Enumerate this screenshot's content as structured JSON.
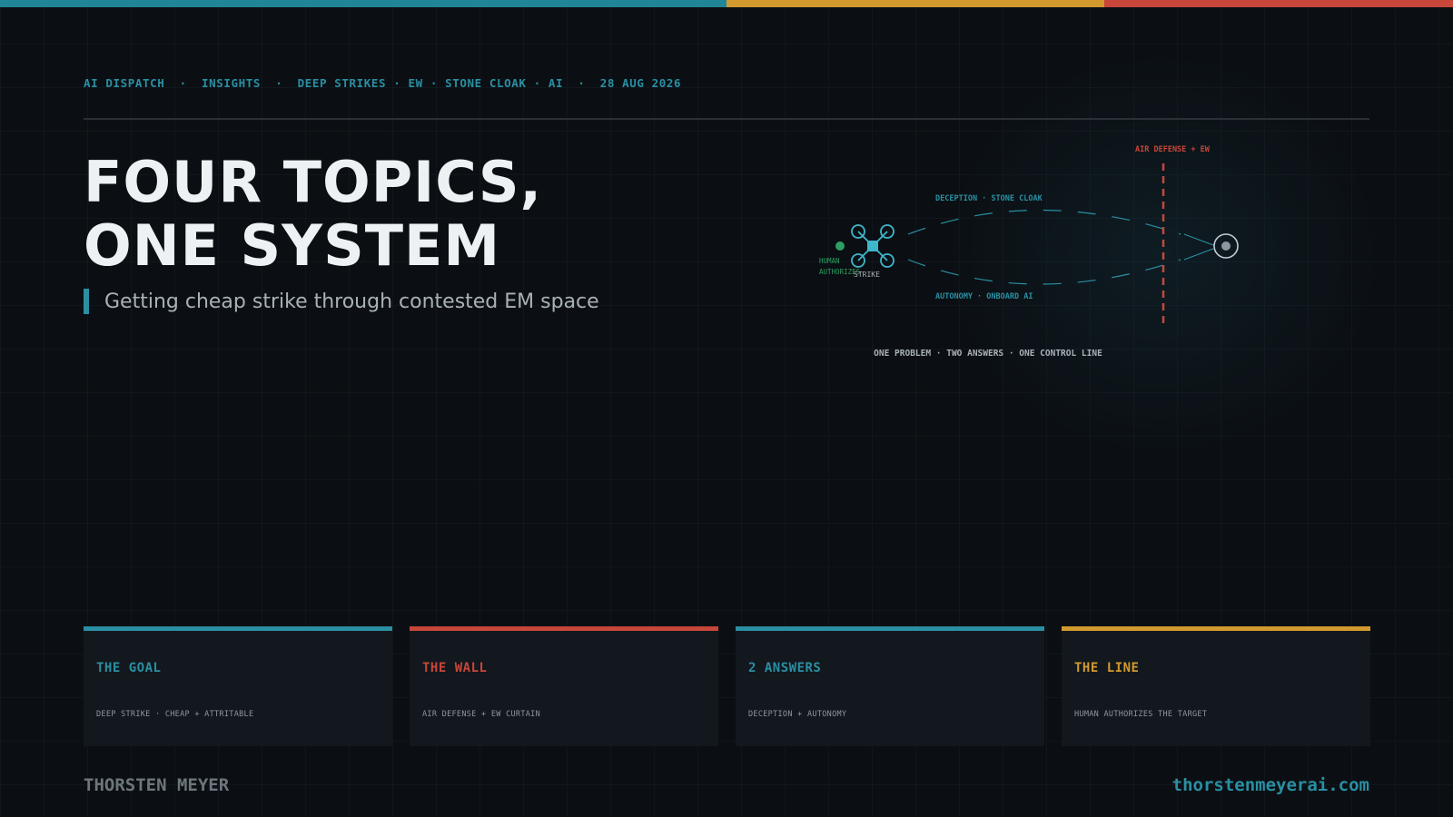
{
  "colors": {
    "teal": "#2a8fa3",
    "amber": "#d29a2e",
    "red": "#c8463a",
    "green": "#2e9e62",
    "text": "#eef1f3",
    "muted": "#a9b1b8"
  },
  "header": {
    "text": "AI DISPATCH  ·  INSIGHTS  ·  DEEP STRIKES · EW · STONE CLOAK · AI  ·  28 AUG 2026"
  },
  "title": {
    "line1": "FOUR TOPICS,",
    "line2": "ONE SYSTEM"
  },
  "subtitle": "Getting cheap strike through contested EM space",
  "diagram": {
    "barrier_label": "AIR DEFENSE + EW",
    "upper_label": "DECEPTION · STONE CLOAK",
    "lower_label": "AUTONOMY · ONBOARD AI",
    "human_label_1": "HUMAN",
    "human_label_2": "AUTHORIZES",
    "strike_label": "STRIKE",
    "caption": "ONE PROBLEM · TWO ANSWERS · ONE CONTROL LINE",
    "drone_icon": "quadcopter-drone-icon",
    "target_icon": "target-icon"
  },
  "cards": [
    {
      "title": "THE GOAL",
      "sub": "DEEP STRIKE · CHEAP + ATTRITABLE",
      "color": "#2a8fa3"
    },
    {
      "title": "THE WALL",
      "sub": "AIR DEFENSE + EW CURTAIN",
      "color": "#c8463a"
    },
    {
      "title": "2 ANSWERS",
      "sub": "DECEPTION + AUTONOMY",
      "color": "#2a8fa3"
    },
    {
      "title": "THE LINE",
      "sub": "HUMAN AUTHORIZES THE TARGET",
      "color": "#d29a2e"
    }
  ],
  "footer": {
    "author": "THORSTEN MEYER",
    "site": "thorstenmeyerai.com"
  }
}
